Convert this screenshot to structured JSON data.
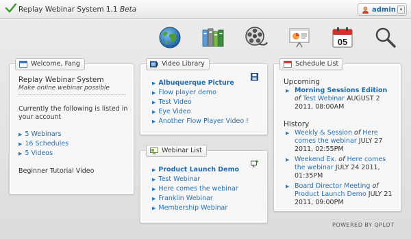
{
  "app": {
    "title": "Replay Webinar System 1.1",
    "title_suffix": "Beta",
    "user": "admin",
    "user_caret": "▾"
  },
  "toolbar": {
    "items": [
      {
        "name": "globe-icon"
      },
      {
        "name": "library-icon"
      },
      {
        "name": "film-reel-icon"
      },
      {
        "name": "presentation-icon"
      },
      {
        "name": "calendar-icon",
        "day": "05"
      },
      {
        "name": "search-icon"
      }
    ]
  },
  "welcome": {
    "tab": "Welcome, Fang",
    "system_name": "Replay Webinar System",
    "tagline": "Make online webinar possible",
    "intro": "Currently the following is listed in your account",
    "links": [
      "5 Webinars",
      "16 Schedules",
      "5 Videos"
    ],
    "tutorial": "Beginner Tutorial Video"
  },
  "video_library": {
    "tab": "Video Library",
    "items": [
      {
        "label": "Albuquerque Picture",
        "bold": true
      },
      {
        "label": "Flow player demo",
        "bold": false
      },
      {
        "label": "Test Video",
        "bold": false
      },
      {
        "label": "Eye Video",
        "bold": false
      },
      {
        "label": "Another Flow Player Video !",
        "bold": false
      }
    ]
  },
  "webinar_list": {
    "tab": "Webinar List",
    "items": [
      {
        "label": "Product Launch Demo",
        "bold": true
      },
      {
        "label": "Test Webinar",
        "bold": false
      },
      {
        "label": "Here comes the webinar",
        "bold": false
      },
      {
        "label": "Franklin Webinar",
        "bold": false
      },
      {
        "label": "Membership Webinar",
        "bold": false
      }
    ]
  },
  "schedule": {
    "tab": "Schedule List",
    "upcoming_title": "Upcoming",
    "upcoming": [
      {
        "session": "Morning Sessions Edition",
        "of": "of",
        "webinar": "Test Webinar",
        "when": "AUGUST 2 2011, 08:00AM"
      }
    ],
    "history_title": "History",
    "history": [
      {
        "session": "Weekly & Session",
        "of": "of",
        "webinar": "Here comes the webinar",
        "when": "JULY 27 2011, 02:55PM"
      },
      {
        "session": "Weekend Ex.",
        "of": "of",
        "webinar": "Here comes the webinar",
        "when": "JULY 24 2011, 01:35PM"
      },
      {
        "session": "Board Director Meeting",
        "of": "of",
        "webinar": "Product Launch Demo",
        "when": "JULY 21 2011, 09:00PM"
      }
    ]
  },
  "footer": "POWERED BY QPLOT",
  "colors": {
    "link": "#2470b3",
    "link_bold": "#1e6bb0",
    "background": "#e3e3e3",
    "panel": "#f6f6f6"
  }
}
